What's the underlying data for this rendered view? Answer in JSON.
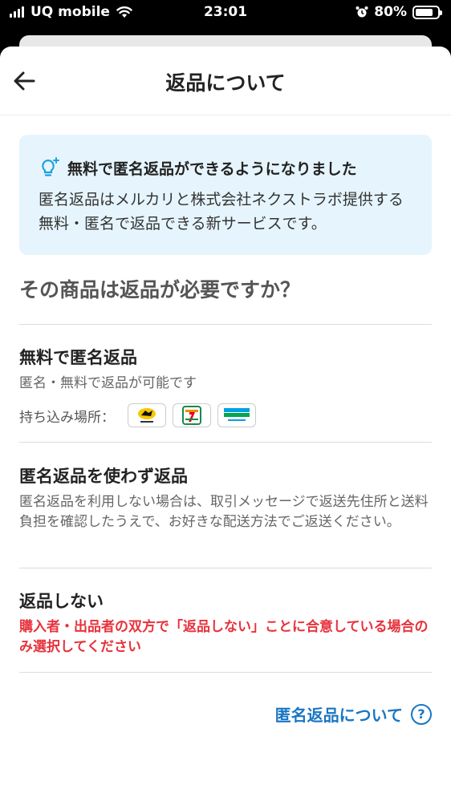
{
  "status_bar": {
    "carrier": "UQ mobile",
    "time": "23:01",
    "battery": "80%",
    "battery_level": 0.8
  },
  "header": {
    "title": "返品について"
  },
  "info_box": {
    "title": "無料で匿名返品ができるようになりました",
    "body": "匿名返品はメルカリと株式会社ネクストラボ提供する無料・匿名で返品できる新サービスです。",
    "icon": "lightbulb-icon",
    "accent": "#1ea0dc"
  },
  "question": "その商品は返品が必要ですか？",
  "options": [
    {
      "title": "無料で匿名返品",
      "desc": "匿名・無料で返品が可能です",
      "dropoff_label": "持ち込み場所：",
      "stores": [
        "yamato-icon",
        "seven-eleven-icon",
        "familymart-icon"
      ]
    },
    {
      "title": "匿名返品を使わず返品",
      "desc": "匿名返品を利用しない場合は、取引メッセージで返送先住所と送料負担を確認したうえで、お好きな配送方法でご返送ください。"
    },
    {
      "title": "返品しない",
      "warning": "購入者・出品者の双方で「返品しない」ことに合意している場合のみ選択してください"
    }
  ],
  "help_link": {
    "label": "匿名返品について",
    "icon": "question-circle-icon"
  },
  "colors": {
    "link": "#1976c3",
    "warning": "#e8323c",
    "info_bg": "#e6f5fd"
  }
}
